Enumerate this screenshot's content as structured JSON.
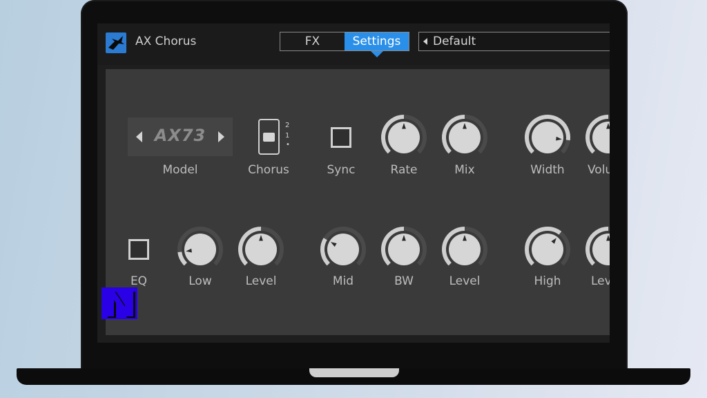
{
  "window": {
    "title": "AX Chorus"
  },
  "tabs": [
    {
      "label": "FX",
      "active": false
    },
    {
      "label": "Settings",
      "active": true
    }
  ],
  "preset": {
    "value": "Default"
  },
  "model": {
    "value": "AX73",
    "label": "Model"
  },
  "chorus": {
    "label": "Chorus",
    "marks": [
      "2",
      "1",
      "•"
    ],
    "position": "1"
  },
  "sync": {
    "label": "Sync",
    "checked": false
  },
  "eq": {
    "label": "EQ",
    "checked": false
  },
  "knobs_row1": [
    {
      "id": "rate",
      "label": "Rate",
      "value": 0.5
    },
    {
      "id": "mix",
      "label": "Mix",
      "value": 0.5
    },
    {
      "id": "width",
      "label": "Width",
      "value": 0.86
    },
    {
      "id": "volume",
      "label": "Volu",
      "value": 0.5
    }
  ],
  "knobs_row2": [
    {
      "id": "low",
      "label": "Low",
      "value": 0.14
    },
    {
      "id": "low-level",
      "label": "Level",
      "value": 0.5
    },
    {
      "id": "mid",
      "label": "Mid",
      "value": 0.28
    },
    {
      "id": "bw",
      "label": "BW",
      "value": 0.5
    },
    {
      "id": "mid-level",
      "label": "Level",
      "value": 0.5
    },
    {
      "id": "high",
      "label": "High",
      "value": 0.64
    },
    {
      "id": "high-level",
      "label": "Lev",
      "value": 0.5
    }
  ],
  "colors": {
    "accent": "#2a8fe8",
    "panel": "#3a3a3a",
    "knob_face": "#d6d6d6",
    "knob_ring": "#4a4a4a",
    "knob_arc": "#cfcfcf",
    "watermark": "#2a00e6"
  },
  "icons": {
    "app_logo": "bird-icon",
    "watermark": "letter-n-logo"
  }
}
